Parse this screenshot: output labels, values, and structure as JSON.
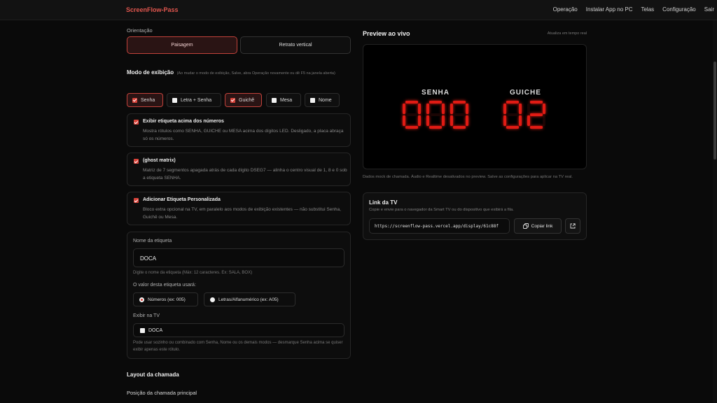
{
  "app": {
    "brand": "ScreenFlow-Pass"
  },
  "nav": [
    "Operação",
    "Instalar App no PC",
    "Telas",
    "Configuração",
    "Sair"
  ],
  "orientation": {
    "label": "Orientação",
    "options": [
      "Paisagem",
      "Retrato vertical"
    ],
    "selected": "Paisagem"
  },
  "display_mode": {
    "title": "Modo de exibição",
    "hint": "(Ao mudar o modo de exibição, Salve, abra Operação novamente ou dê F5 na janela aberta)",
    "chips": [
      {
        "label": "Senha",
        "checked": true
      },
      {
        "label": "Letra + Senha",
        "checked": false
      },
      {
        "label": "Guichê",
        "checked": true
      },
      {
        "label": "Mesa",
        "checked": false
      },
      {
        "label": "Nome",
        "checked": false
      }
    ]
  },
  "options": [
    {
      "title": "Exibir etiqueta acima dos números",
      "desc": "Mostra rótulos como SENHA, GUICHE ou MESA acima dos dígitos LED. Desligado, a placa abraça só os números.",
      "checked": true
    },
    {
      "title": "(ghost matrix)",
      "desc": "Matriz de 7 segmentos apagada atrás de cada dígito DSEG7 — alinha o centro visual de 1, 8 e 0 sob a etiqueta SENHA.",
      "checked": true
    },
    {
      "title": "Adicionar Etiqueta Personalizada",
      "desc": "Bloco extra opcional na TV, em paralelo aos modos de exibição existentes — não substitui Senha, Guichê ou Mesa.",
      "checked": true
    }
  ],
  "custom_label": {
    "name_label": "Nome da etiqueta",
    "name_value": "DOCA",
    "name_help": "Digite o nome da etiqueta (Máx: 12 caracteres. Ex: SALA, BOX)",
    "value_label": "O valor desta etiqueta usará:",
    "value_options": [
      {
        "label": "Números (ex: 005)",
        "selected": true
      },
      {
        "label": "Letras/Alfanumérico (ex: A05)",
        "selected": false
      }
    ],
    "show_label": "Exibir na TV",
    "show_value": "DOCA",
    "show_checked": false,
    "show_help": "Pode usar sozinho ou combinado com Senha, Nome ou os demais modos — desmarque Senha acima se quiser exibir apenas este rótulo."
  },
  "layout_section": {
    "title": "Layout da chamada",
    "sub": "Posição da chamada principal"
  },
  "preview": {
    "title": "Preview ao vivo",
    "refresh_note": "Atualiza em tempo real",
    "blocks": [
      {
        "label": "SENHA",
        "value": "000"
      },
      {
        "label": "GUICHE",
        "value": "02"
      }
    ],
    "led_color": "#e01b14",
    "note": "Dados mock de chamada. Áudio e Realtime desativados no preview. Salve as configurações para aplicar na TV real."
  },
  "tv_link": {
    "title": "Link da TV",
    "desc": "Copie e envie para o navegador da Smart TV ou do dispositivo que exibirá a fila.",
    "url": "https://screenflow-pass.vercel.app/display/61c88f",
    "copy_label": "Copiar link"
  },
  "colors": {
    "accent": "#e0564e",
    "check": "#d9433a",
    "led": "#e01b14"
  }
}
